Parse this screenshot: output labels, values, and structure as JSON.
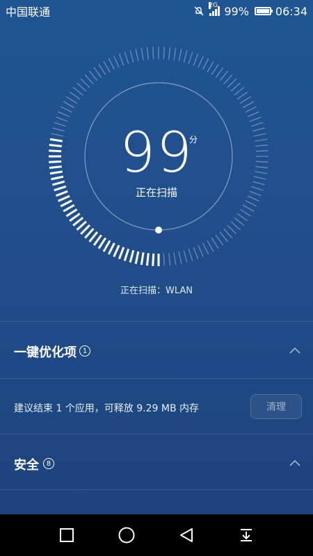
{
  "status": {
    "carrier": "中国联通",
    "network_type": "2G",
    "battery": "99%",
    "time": "06:34",
    "battery_level": 0.99
  },
  "scan": {
    "score": "99",
    "unit": "分",
    "status_text": "正在扫描",
    "current_item": "正在扫描：WLAN",
    "progress": 0.28
  },
  "sections": [
    {
      "title": "一键优化项",
      "count": "1",
      "icon": "chevron-up-icon"
    },
    {
      "title": "安全",
      "count": "8",
      "icon": "chevron-up-icon"
    }
  ],
  "suggestion": {
    "text": "建议结束 1 个应用，可释放 9.29 MB 内存",
    "button": "清理"
  },
  "navbar": {
    "icons": [
      "recents-square-icon",
      "home-circle-icon",
      "back-triangle-icon",
      "notification-pull-icon"
    ]
  }
}
